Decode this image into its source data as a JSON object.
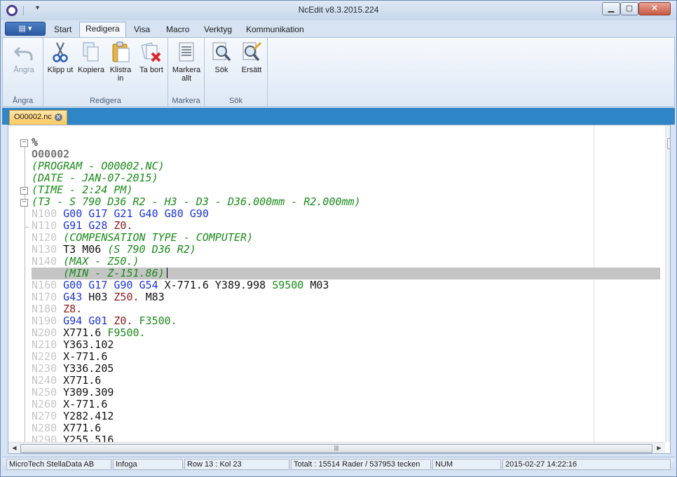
{
  "window": {
    "title": "NcEdit v8.3.2015.224"
  },
  "tabs": [
    "Start",
    "Redigera",
    "Visa",
    "Macro",
    "Verktyg",
    "Kommunikation"
  ],
  "active_tab": "Redigera",
  "ribbon": {
    "groups": [
      {
        "label": "Ångra",
        "buttons": [
          {
            "label": "Ångra",
            "icon": "undo-icon",
            "enabled": false
          }
        ]
      },
      {
        "label": "Redigera",
        "buttons": [
          {
            "label": "Klipp ut",
            "icon": "scissors-icon"
          },
          {
            "label": "Kopiera",
            "icon": "copy-icon"
          },
          {
            "label": "Klistra in",
            "icon": "paste-icon"
          },
          {
            "label": "Ta bort",
            "icon": "delete-icon"
          }
        ]
      },
      {
        "label": "Markera",
        "buttons": [
          {
            "label": "Markera allt",
            "icon": "select-all-icon"
          }
        ]
      },
      {
        "label": "Sök",
        "buttons": [
          {
            "label": "Sök",
            "icon": "search-icon"
          },
          {
            "label": "Ersätt",
            "icon": "replace-icon"
          }
        ]
      }
    ]
  },
  "document_tab": {
    "name": "O00002.nc"
  },
  "editor": {
    "current_line_index": 11,
    "lines": [
      [
        [
          "t",
          "%"
        ]
      ],
      [
        [
          "hdr",
          "O00002"
        ]
      ],
      [
        [
          "cm",
          "(PROGRAM - O00002.NC)"
        ]
      ],
      [
        [
          "cm",
          "(DATE - JAN-07-2015)"
        ]
      ],
      [
        [
          "cm",
          "(TIME - 2:24 PM)"
        ]
      ],
      [
        [
          "cm",
          "(T3 - S 790 D36 R2 - H3 - D3 - D36.000mm - R2.000mm)"
        ]
      ],
      [
        [
          "ln",
          "N100 "
        ],
        [
          "g",
          "G00 G17 G21 G40 G80 G90"
        ]
      ],
      [
        [
          "ln",
          "N110 "
        ],
        [
          "g",
          "G91 G28 "
        ],
        [
          "z",
          "Z0."
        ]
      ],
      [
        [
          "ln",
          "N120 "
        ],
        [
          "cm",
          "(COMPENSATION TYPE - COMPUTER)"
        ]
      ],
      [
        [
          "ln",
          "N130 "
        ],
        [
          "t",
          "T3 M06 "
        ],
        [
          "cm",
          "(S 790 D36 R2)"
        ]
      ],
      [
        [
          "ln",
          "N140 "
        ],
        [
          "cm",
          "(MAX - Z50.)"
        ]
      ],
      [
        [
          "ln",
          "N150 "
        ],
        [
          "cm",
          "(MIN - Z-151.86)"
        ]
      ],
      [
        [
          "ln",
          "N160 "
        ],
        [
          "g",
          "G00 G17 G90 G54 "
        ],
        [
          "t",
          "X-771.6 Y389.998 "
        ],
        [
          "f",
          "S9500 "
        ],
        [
          "t",
          "M03"
        ]
      ],
      [
        [
          "ln",
          "N170 "
        ],
        [
          "g",
          "G43 "
        ],
        [
          "t",
          "H03 "
        ],
        [
          "z",
          "Z50. "
        ],
        [
          "t",
          "M83"
        ]
      ],
      [
        [
          "ln",
          "N180 "
        ],
        [
          "z",
          "Z8."
        ]
      ],
      [
        [
          "ln",
          "N190 "
        ],
        [
          "g",
          "G94 G01 "
        ],
        [
          "z",
          "Z0. "
        ],
        [
          "f",
          "F3500."
        ]
      ],
      [
        [
          "ln",
          "N200 "
        ],
        [
          "t",
          "X771.6 "
        ],
        [
          "f",
          "F9500."
        ]
      ],
      [
        [
          "ln",
          "N210 "
        ],
        [
          "t",
          "Y363.102"
        ]
      ],
      [
        [
          "ln",
          "N220 "
        ],
        [
          "t",
          "X-771.6"
        ]
      ],
      [
        [
          "ln",
          "N230 "
        ],
        [
          "t",
          "Y336.205"
        ]
      ],
      [
        [
          "ln",
          "N240 "
        ],
        [
          "t",
          "X771.6"
        ]
      ],
      [
        [
          "ln",
          "N250 "
        ],
        [
          "t",
          "Y309.309"
        ]
      ],
      [
        [
          "ln",
          "N260 "
        ],
        [
          "t",
          "X-771.6"
        ]
      ],
      [
        [
          "ln",
          "N270 "
        ],
        [
          "t",
          "Y282.412"
        ]
      ],
      [
        [
          "ln",
          "N280 "
        ],
        [
          "t",
          "X771.6"
        ]
      ],
      [
        [
          "ln",
          "N290 "
        ],
        [
          "t",
          "Y255.516"
        ]
      ]
    ]
  },
  "statusbar": {
    "company": "MicroTech StellaData AB",
    "mode": "Infoga",
    "position": "Row 13 : Kol 23",
    "totals": "Totalt : 15514 Rader / 537953 tecken",
    "num": "NUM",
    "datetime": "2015-02-27 14:22:16"
  }
}
